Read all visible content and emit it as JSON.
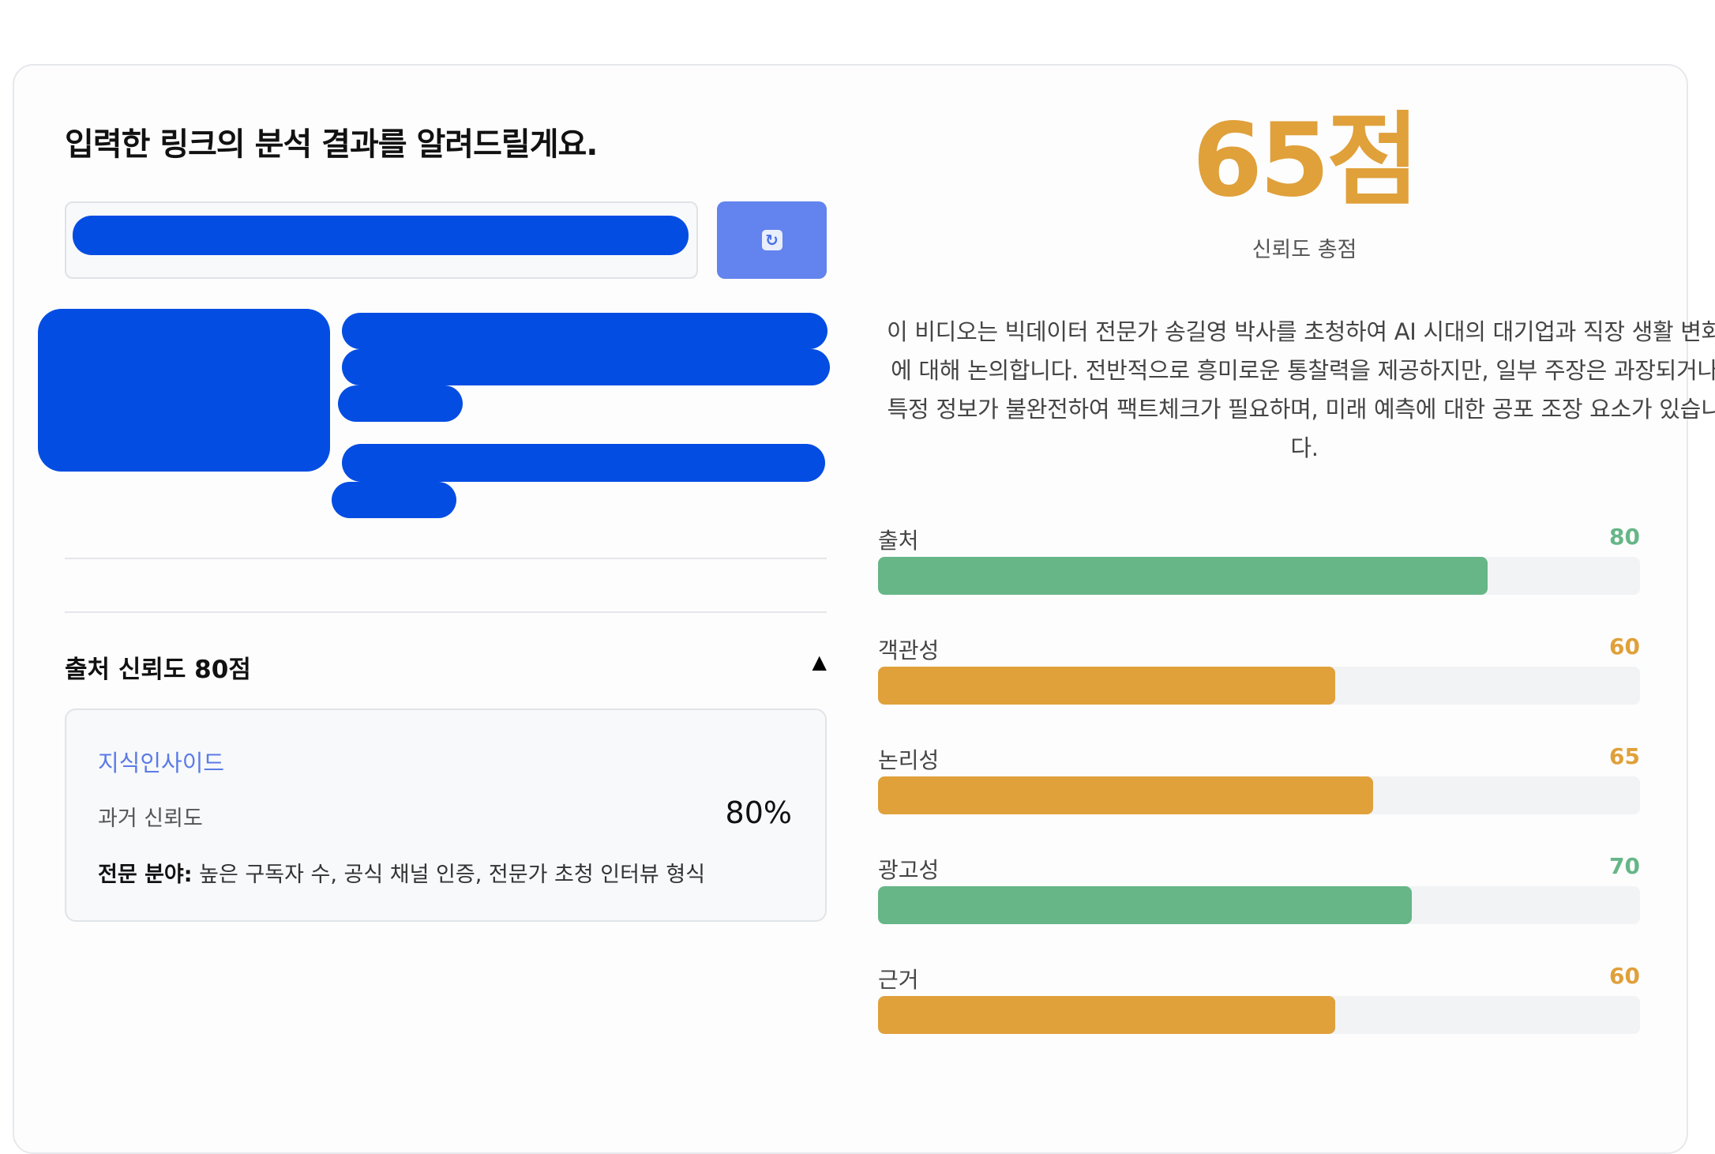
{
  "header": {
    "title": "입력한 링크의 분석 결과를 알려드릴게요."
  },
  "url_input": {
    "value": "",
    "redacted": true
  },
  "refresh_button": {
    "icon": "refresh-icon"
  },
  "score": {
    "total": "65점",
    "caption": "신뢰도 총점",
    "color": "#e0a03a"
  },
  "summary": "이 비디오는 빅데이터 전문가 송길영 박사를 초청하여 AI 시대의 대기업과 직장 생활 변화에 대해 논의합니다. 전반적으로 흥미로운 통찰력을 제공하지만, 일부 주장은 과장되거나 특정 정보가 불완전하여 팩트체크가 필요하며, 미래 예측에 대한 공포 조장 요소가 있습니다.",
  "source_section": {
    "title": "출처 신뢰도 80점",
    "collapse_icon": "▲",
    "source_name": "지식인사이드",
    "history_label": "과거 신뢰도",
    "history_value": "80%",
    "field_label": "전문 분야:",
    "field_value": " 높은 구독자 수, 공식 채널 인증, 전문가 초청 인터뷰 형식"
  },
  "metrics": [
    {
      "label": "출처",
      "value": 80,
      "color": "#66b687"
    },
    {
      "label": "객관성",
      "value": 60,
      "color": "#e0a03a"
    },
    {
      "label": "논리성",
      "value": 65,
      "color": "#e0a03a"
    },
    {
      "label": "광고성",
      "value": 70,
      "color": "#66b687"
    },
    {
      "label": "근거",
      "value": 60,
      "color": "#e0a03a"
    }
  ],
  "colors": {
    "green": "#66b687",
    "orange": "#e0a03a",
    "accent_blue": "#6383ee",
    "redaction": "#044de3"
  }
}
